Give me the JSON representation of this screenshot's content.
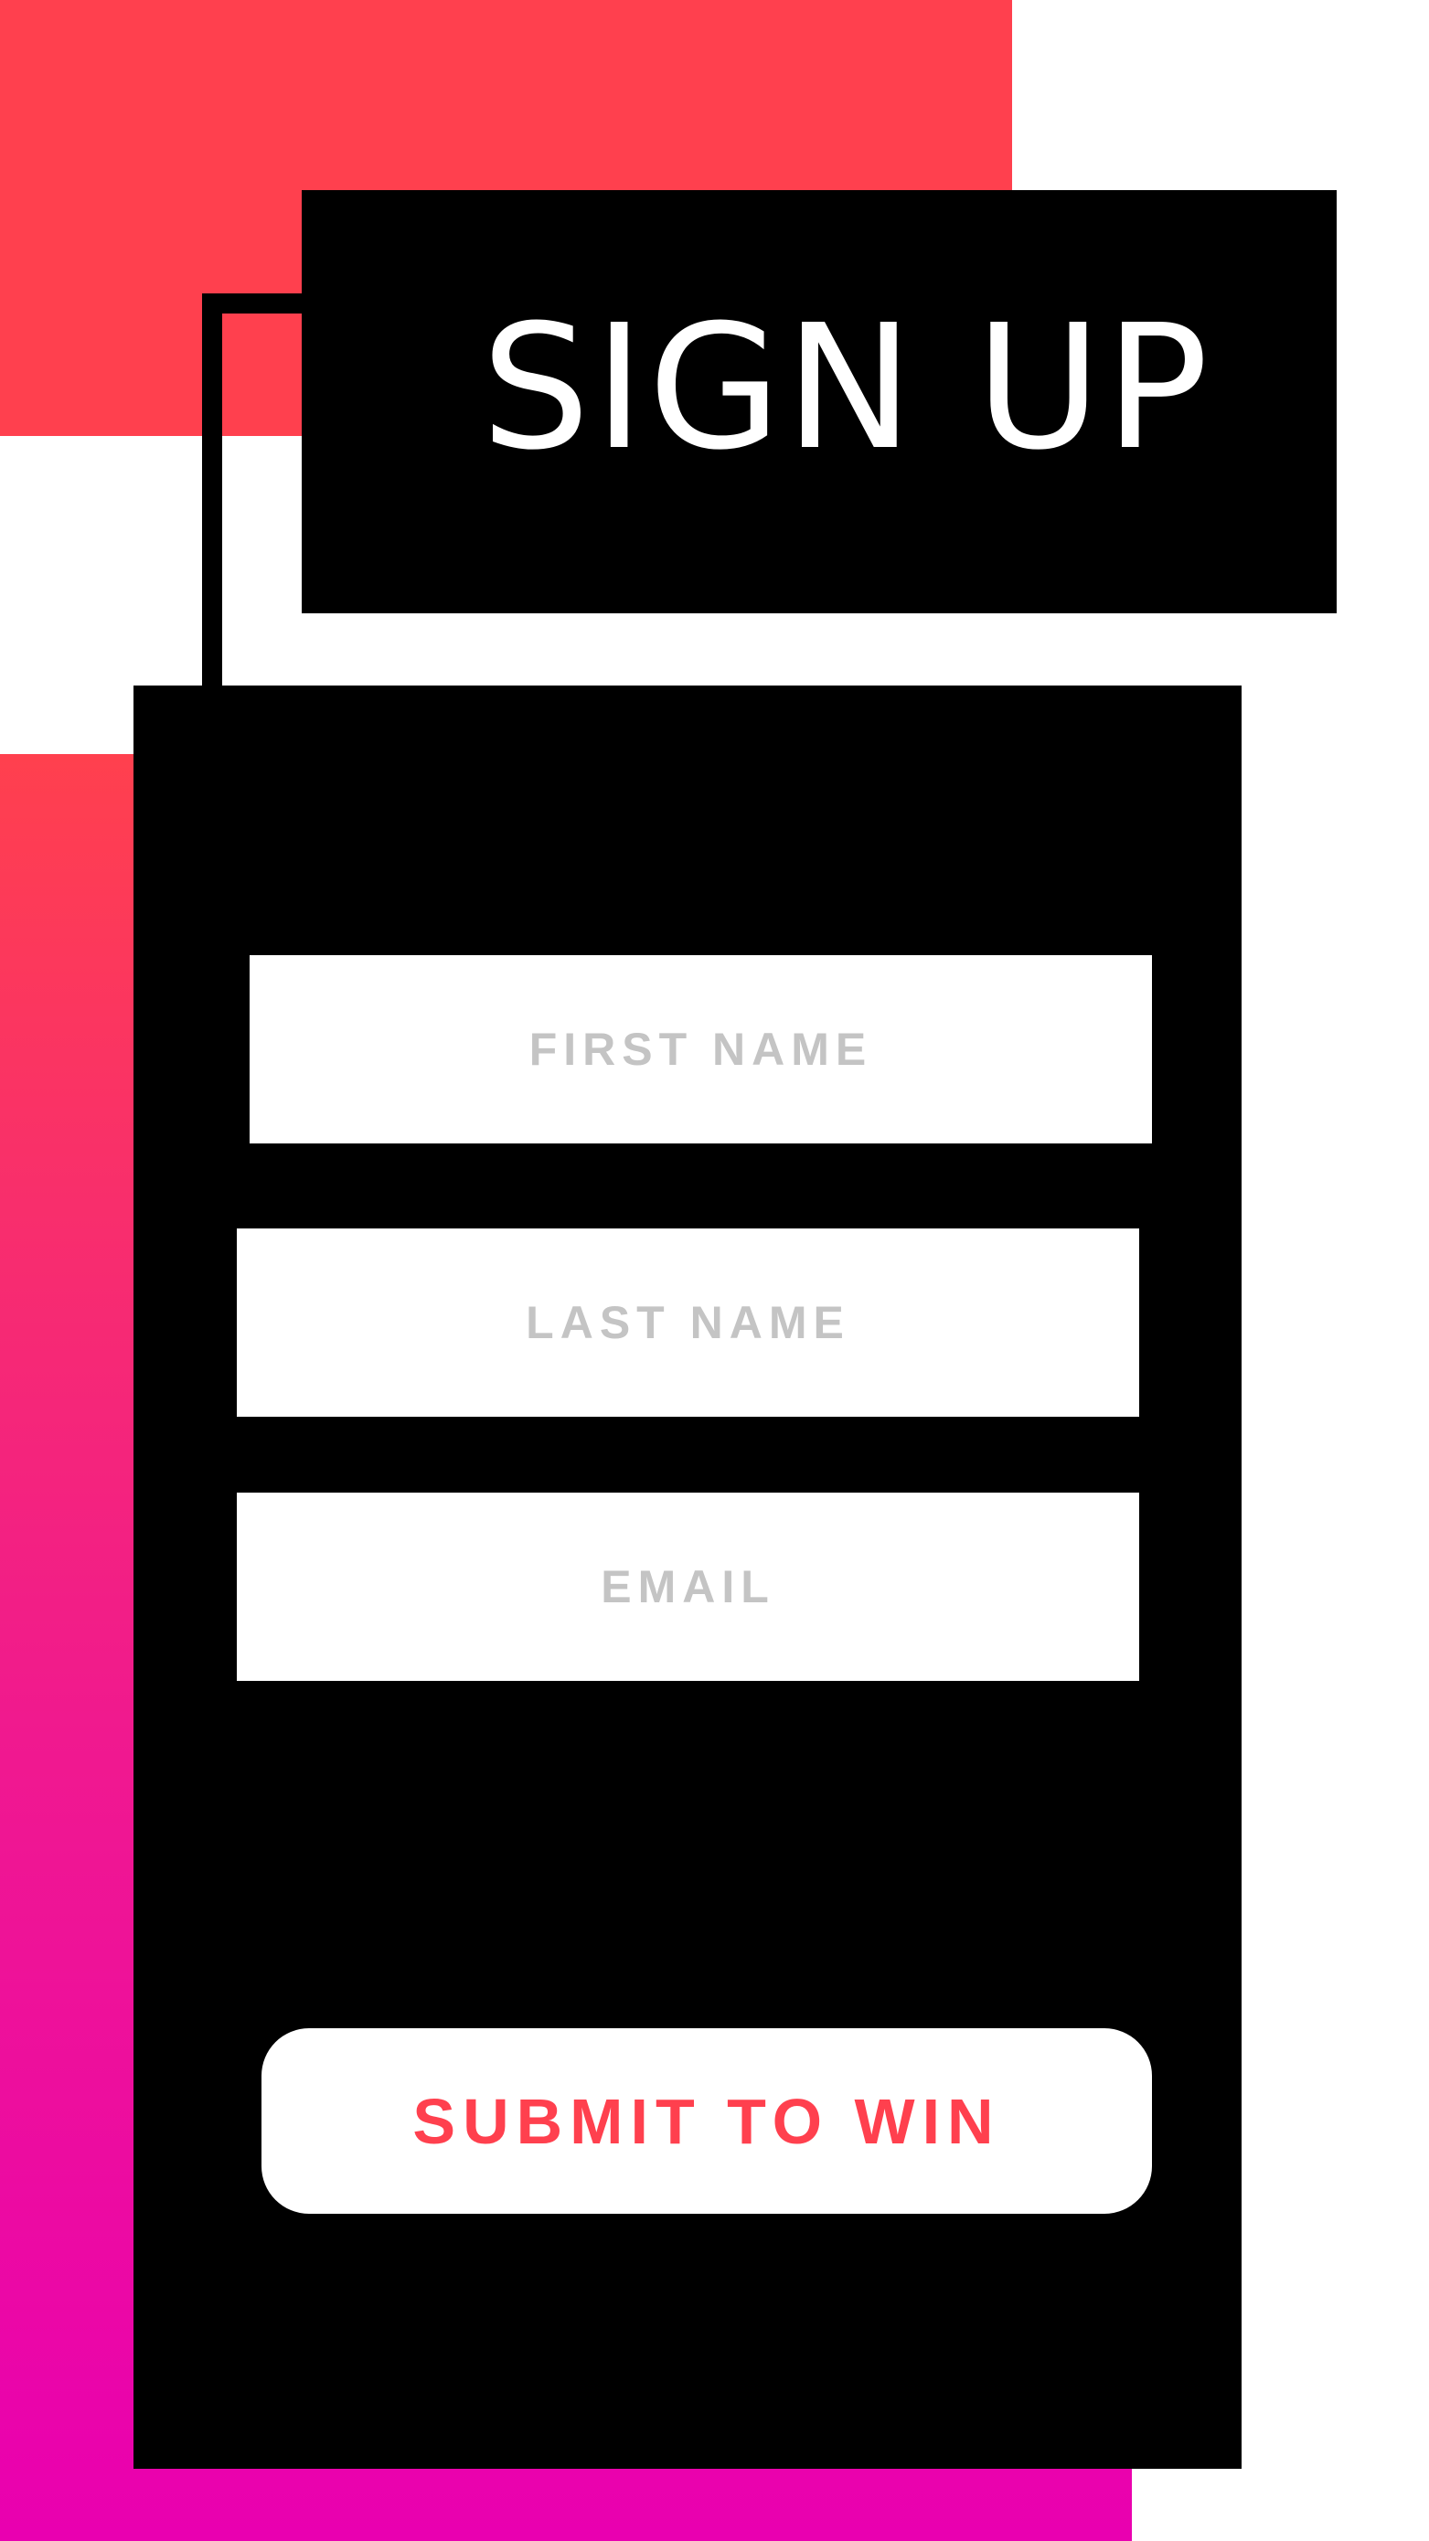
{
  "header": {
    "title": "SIGN UP"
  },
  "form": {
    "first_name_placeholder": "FIRST NAME",
    "last_name_placeholder": "LAST NAME",
    "email_placeholder": "EMAIL",
    "submit_label": "SUBMIT TO WIN"
  },
  "colors": {
    "accent": "#ff404e",
    "gradient_end": "#e900b0",
    "panel": "#000000",
    "placeholder": "#c4c4c4"
  }
}
